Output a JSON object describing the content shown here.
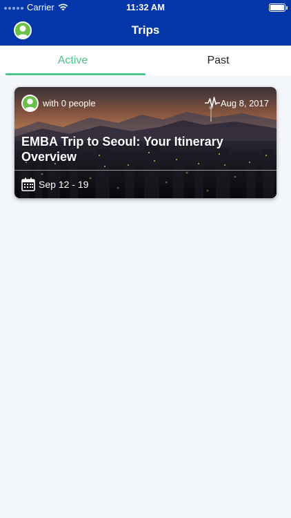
{
  "status_bar": {
    "carrier": "Carrier",
    "time": "11:32 AM"
  },
  "nav": {
    "title": "Trips"
  },
  "tabs": [
    {
      "label": "Active",
      "selected": true
    },
    {
      "label": "Past",
      "selected": false
    }
  ],
  "trips": [
    {
      "people": "with 0 people",
      "updated": "Aug 8, 2017",
      "title": "EMBA Trip to Seoul:  Your Itinerary Overview",
      "dates": "Sep 12 - 19"
    }
  ],
  "colors": {
    "brand": "#0336a8",
    "accent": "#4cc38a",
    "avatar": "#6cc04a",
    "background": "#f3f6fa"
  },
  "icons": [
    "wifi-icon",
    "battery-icon",
    "user-avatar-icon",
    "pulse-icon",
    "calendar-icon"
  ]
}
